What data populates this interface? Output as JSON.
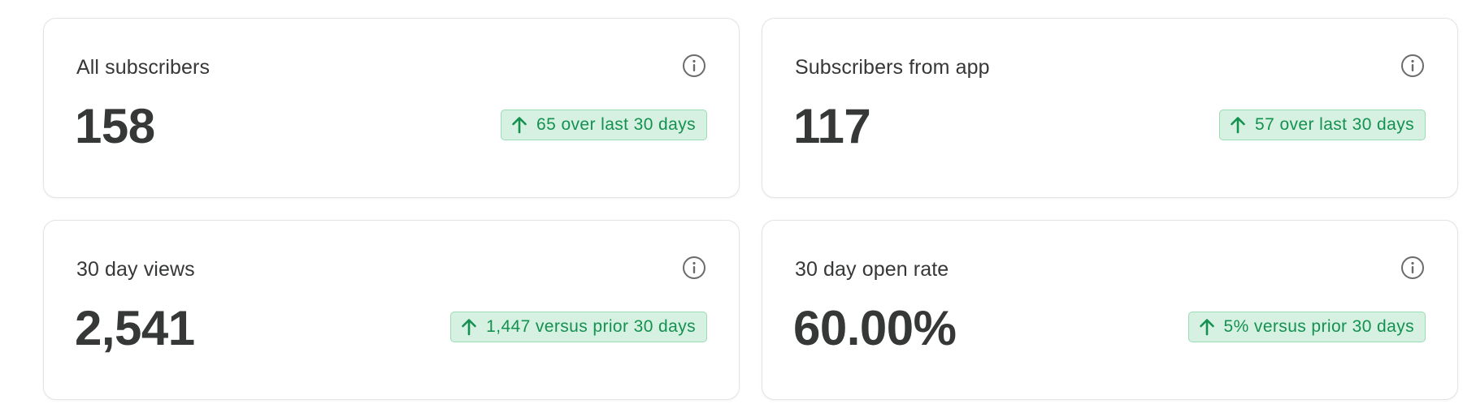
{
  "colors": {
    "card_border": "#e3e3e3",
    "text_primary": "#363737",
    "badge_bg": "#d6f1e1",
    "badge_border": "#9bdbb6",
    "badge_text": "#149151",
    "icon": "#6b6b6b"
  },
  "cards": [
    {
      "title": "All subscribers",
      "value": "158",
      "trend_icon": "arrow-up-icon",
      "trend_text": "65 over last 30 days",
      "info_icon": "info-icon"
    },
    {
      "title": "Subscribers from app",
      "value": "117",
      "trend_icon": "arrow-up-icon",
      "trend_text": "57 over last 30 days",
      "info_icon": "info-icon"
    },
    {
      "title": "30 day views",
      "value": "2,541",
      "trend_icon": "arrow-up-icon",
      "trend_text": "1,447 versus prior 30 days",
      "info_icon": "info-icon"
    },
    {
      "title": "30 day open rate",
      "value": "60.00%",
      "trend_icon": "arrow-up-icon",
      "trend_text": "5% versus prior 30 days",
      "info_icon": "info-icon"
    }
  ]
}
